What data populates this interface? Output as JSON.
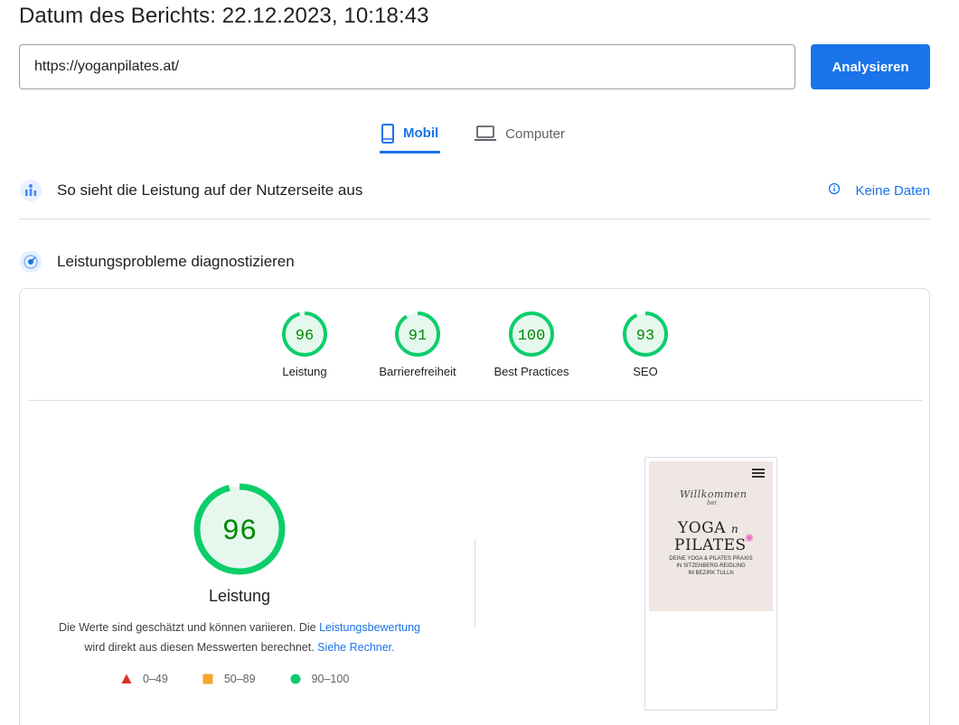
{
  "report": {
    "title": "Datum des Berichts: 22.12.2023, 10:18:43"
  },
  "search": {
    "url": "https://yoganpilates.at/",
    "analyze_label": "Analysieren"
  },
  "tabs": [
    {
      "label": "Mobil",
      "icon": "smartphone-icon",
      "active": true
    },
    {
      "label": "Computer",
      "icon": "laptop-icon",
      "active": false
    }
  ],
  "field_data": {
    "title": "So sieht die Leistung auf der Nutzerseite aus",
    "status": "Keine Daten"
  },
  "diagnose": {
    "title": "Leistungsprobleme diagnostizieren"
  },
  "scores": [
    {
      "value": 96,
      "label": "Leistung"
    },
    {
      "value": 91,
      "label": "Barrierefreiheit"
    },
    {
      "value": 100,
      "label": "Best Practices"
    },
    {
      "value": 93,
      "label": "SEO"
    }
  ],
  "main_score": {
    "value": 96,
    "label": "Leistung",
    "desc_part1": "Die Werte sind geschätzt und können variieren. Die ",
    "desc_link1": "Leistungsbewertung",
    "desc_part2": "wird direkt aus diesen Messwerten berechnet. ",
    "desc_link2": "Siehe Rechner."
  },
  "legend": [
    {
      "range": "0–49",
      "shape": "triangle",
      "color": "#d93025"
    },
    {
      "range": "50–89",
      "shape": "square",
      "color": "#f4a62a"
    },
    {
      "range": "90–100",
      "shape": "circle",
      "color": "#0cce6b"
    }
  ],
  "preview": {
    "willkommen": "Willkommen",
    "bei": "bei",
    "yoga": "YOGA",
    "n": "n",
    "pilates": "PILATES",
    "line1": "DEINE YOGA & PILATES PRAXIS",
    "line2": "IN SITZENBERG-REIDLING",
    "line3": "IM BEZIRK TULLN"
  },
  "colors": {
    "accent": "#1a73e8",
    "good": "#0cce6b",
    "good_text": "#008800",
    "good_fill": "#e6f8ee"
  }
}
